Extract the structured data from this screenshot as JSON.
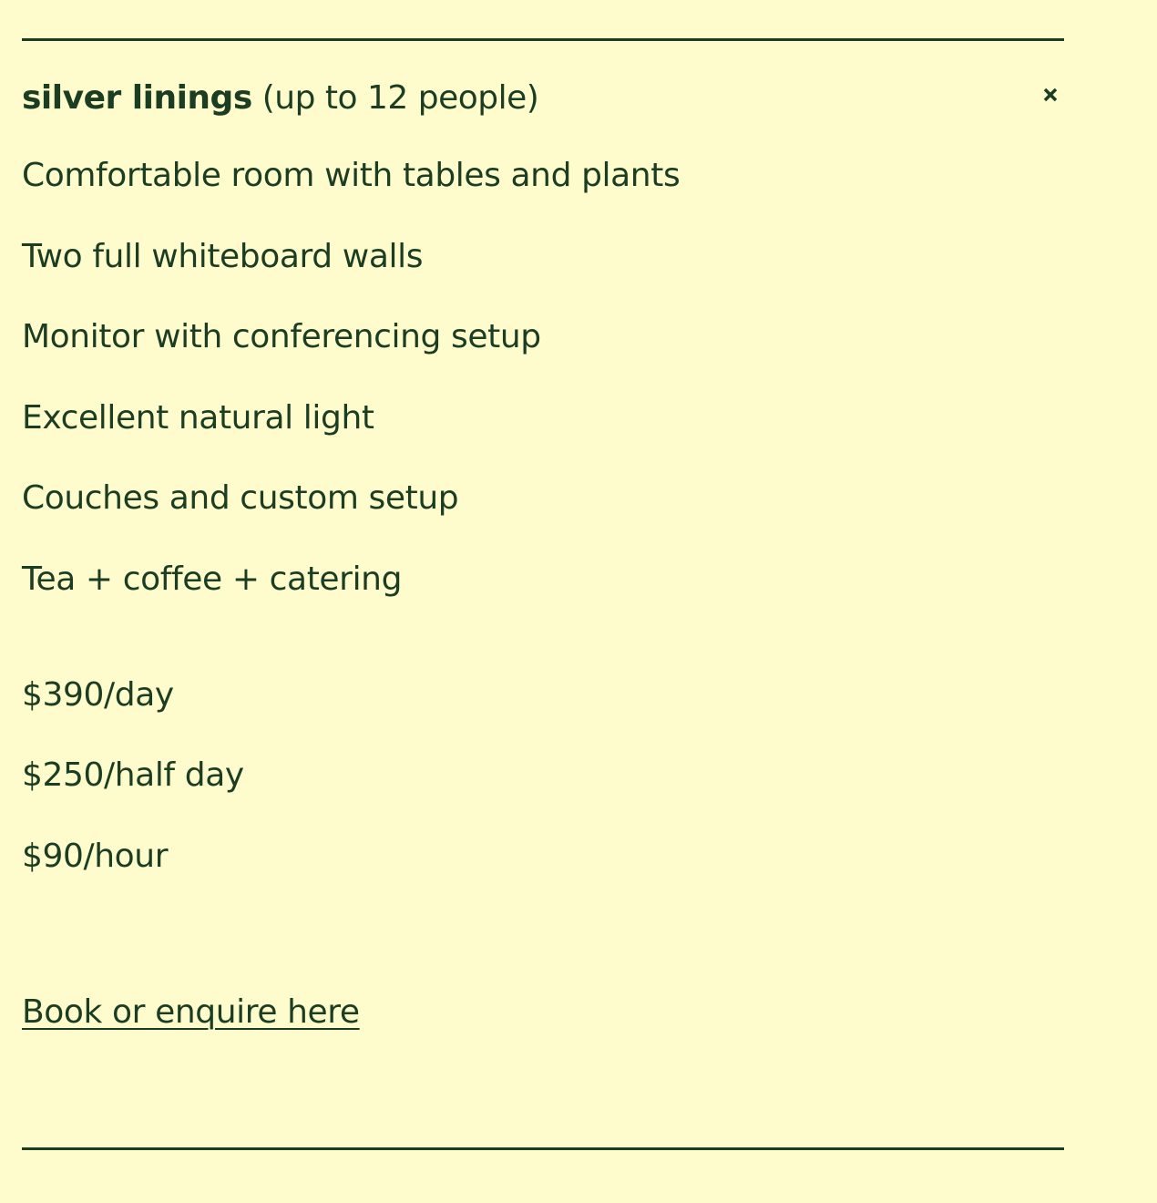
{
  "room": {
    "name": "silver linings",
    "capacity": "(up to 12 people)",
    "close_icon": "close-icon",
    "features": [
      "Comfortable room with tables and plants",
      "Two full whiteboard walls",
      "Monitor with conferencing setup",
      "Excellent natural light",
      "Couches and custom setup",
      "Tea + coffee + catering"
    ],
    "prices": [
      "$390/day",
      "$250/half day",
      "$90/hour"
    ],
    "cta_label": "Book or enquire here"
  },
  "colors": {
    "background": "#fefccc",
    "text": "#1c3d22"
  }
}
